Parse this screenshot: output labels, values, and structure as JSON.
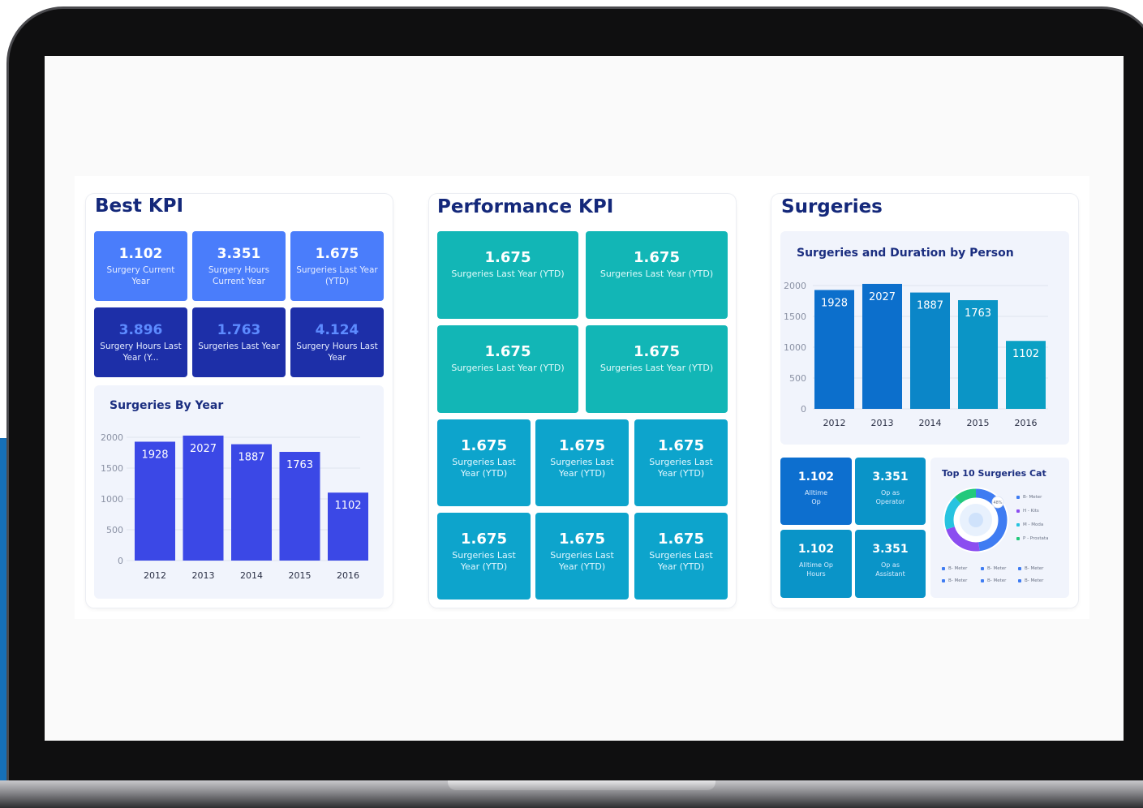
{
  "best_kpi": {
    "title": "Best KPI",
    "tiles": [
      {
        "value": "1.102",
        "label": "Surgery Current Year"
      },
      {
        "value": "3.351",
        "label": "Surgery Hours Current Year"
      },
      {
        "value": "1.675",
        "label": "Surgeries Last Year (YTD)"
      },
      {
        "value": "3.896",
        "label": "Surgery Hours Last Year (Y..."
      },
      {
        "value": "1.763",
        "label": "Surgeries Last Year"
      },
      {
        "value": "4.124",
        "label": "Surgery Hours Last Year"
      }
    ]
  },
  "performance_kpi": {
    "title": "Performance KPI",
    "tiles": [
      {
        "value": "1.675",
        "label": "Surgeries Last Year (YTD)"
      },
      {
        "value": "1.675",
        "label": "Surgeries Last Year (YTD)"
      },
      {
        "value": "1.675",
        "label": "Surgeries Last Year (YTD)"
      },
      {
        "value": "1.675",
        "label": "Surgeries Last Year (YTD)"
      },
      {
        "value": "1.675",
        "label": "Surgeries Last Year (YTD)"
      },
      {
        "value": "1.675",
        "label": "Surgeries Last Year (YTD)"
      },
      {
        "value": "1.675",
        "label": "Surgeries Last Year (YTD)"
      },
      {
        "value": "1.675",
        "label": "Surgeries Last Year (YTD)"
      },
      {
        "value": "1.675",
        "label": "Surgeries Last Year (YTD)"
      },
      {
        "value": "1.675",
        "label": "Surgeries Last Year (YTD)"
      }
    ]
  },
  "surgeries": {
    "title": "Surgeries",
    "mini_tiles": [
      {
        "value": "1.102",
        "label": "Alltime Op"
      },
      {
        "value": "3.351",
        "label": "Op as Operator"
      },
      {
        "value": "1.102",
        "label": "Alltime Op Hours"
      },
      {
        "value": "3.351",
        "label": "Op as Assistant"
      }
    ],
    "donut": {
      "title": "Top 10 Surgeries Cat",
      "center_label": "48%",
      "legend_right": [
        {
          "label": "B- Meter",
          "color": "#3f7cf2"
        },
        {
          "label": "H - Kits",
          "color": "#8b4df0"
        },
        {
          "label": "M - Moda",
          "color": "#27c3e0"
        },
        {
          "label": "P - Prostata",
          "color": "#22c97c"
        }
      ],
      "legend_bottom": [
        {
          "label": "B- Meter",
          "color": "#3f7cf2"
        },
        {
          "label": "B- Meter",
          "color": "#3f7cf2"
        },
        {
          "label": "B- Meter",
          "color": "#3f7cf2"
        },
        {
          "label": "B- Meter",
          "color": "#3f7cf2"
        },
        {
          "label": "B- Meter",
          "color": "#3f7cf2"
        },
        {
          "label": "B- Meter",
          "color": "#3f7cf2"
        }
      ]
    }
  },
  "chart_data": [
    {
      "type": "bar",
      "title": "Surgeries By Year",
      "categories": [
        "2012",
        "2013",
        "2014",
        "2015",
        "2016"
      ],
      "values": [
        1928,
        2027,
        1887,
        1763,
        1102
      ],
      "yticks": [
        0,
        500,
        1000,
        1500,
        2000
      ],
      "ylim": [
        0,
        2000
      ],
      "color": "#3b48e6",
      "grid": true
    },
    {
      "type": "bar",
      "title": "Surgeries and Duration by Person",
      "categories": [
        "2012",
        "2013",
        "2014",
        "2015",
        "2016"
      ],
      "values": [
        1928,
        2027,
        1887,
        1763,
        1102
      ],
      "yticks": [
        0,
        500,
        1000,
        1500,
        2000
      ],
      "ylim": [
        0,
        2000
      ],
      "colors": [
        "#0c6fcc",
        "#0c6fcc",
        "#0b86c8",
        "#0b95c6",
        "#0aa0c4"
      ],
      "grid": true
    },
    {
      "type": "pie",
      "title": "Top 10 Surgeries Cat",
      "slices": [
        {
          "label": "B- Meter",
          "value": 48,
          "color": "#3f7cf2"
        },
        {
          "label": "H - Kits",
          "value": 22,
          "color": "#8b4df0"
        },
        {
          "label": "M - Moda",
          "value": 18,
          "color": "#27c3e0"
        },
        {
          "label": "P - Prostata",
          "value": 12,
          "color": "#22c97c"
        }
      ]
    }
  ]
}
